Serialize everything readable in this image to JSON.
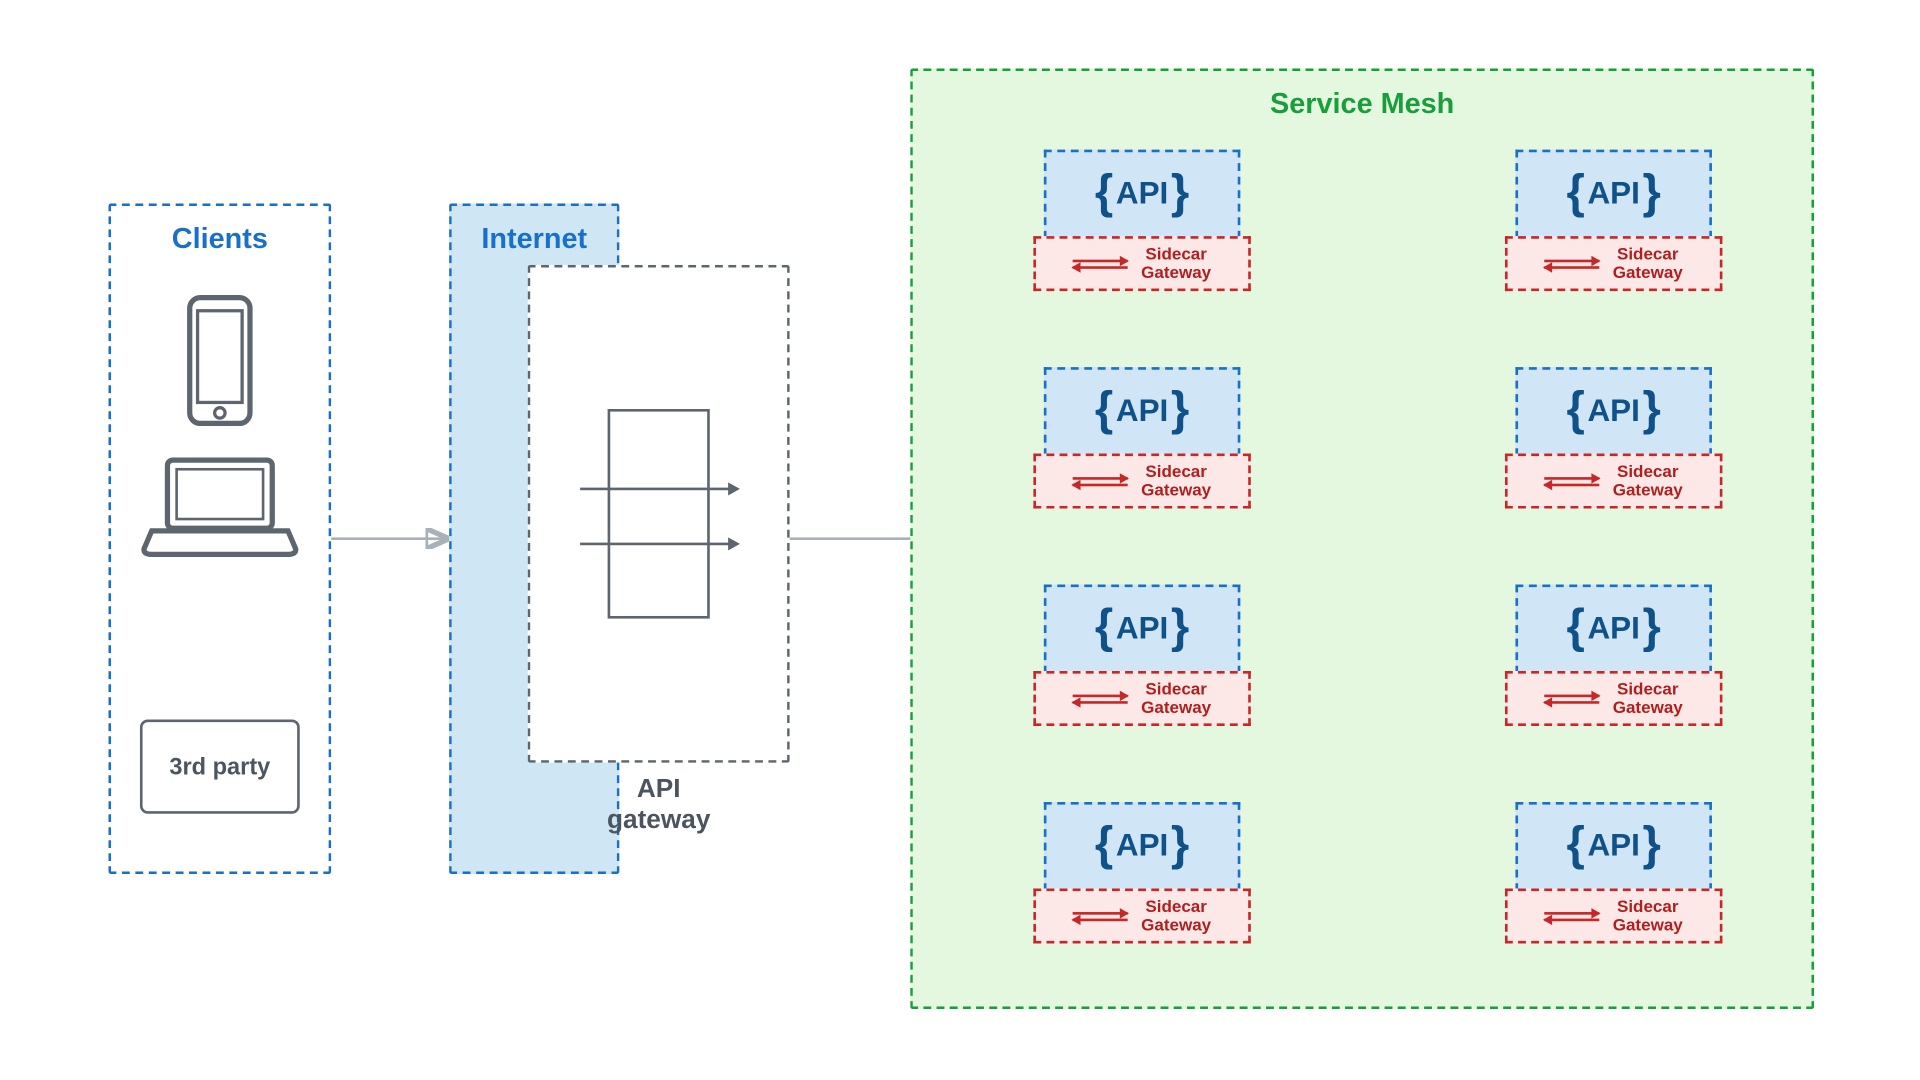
{
  "clients": {
    "title": "Clients",
    "third_party": "3rd party"
  },
  "internet": {
    "title": "Internet"
  },
  "gateway": {
    "label_line1": "API",
    "label_line2": "gateway"
  },
  "mesh": {
    "title": "Service Mesh",
    "api_label": "API",
    "sidecar_line1": "Sidecar",
    "sidecar_line2": "Gateway",
    "services": [
      {
        "col": 0,
        "row": 0
      },
      {
        "col": 0,
        "row": 1
      },
      {
        "col": 0,
        "row": 2
      },
      {
        "col": 0,
        "row": 3
      },
      {
        "col": 1,
        "row": 0
      },
      {
        "col": 1,
        "row": 1
      },
      {
        "col": 1,
        "row": 2
      },
      {
        "col": 1,
        "row": 3
      }
    ]
  },
  "colors": {
    "blue": "#1a6fc9",
    "blue_dark": "#10518a",
    "green": "#1a9e3c",
    "green_bg": "#e4f7df",
    "red": "#c62828",
    "gray": "#5d666e",
    "conn": "#a9b1b8"
  }
}
